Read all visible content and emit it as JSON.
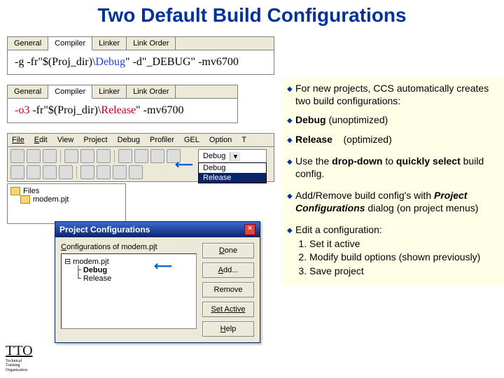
{
  "title": "Two Default Build Configurations",
  "tabs": {
    "general": "General",
    "compiler": "Compiler",
    "linker": "Linker",
    "linkorder": "Link Order"
  },
  "pane1": {
    "p1": "-g -fr\"$(Proj_dir)\\",
    "p2": "Debug",
    "p3": "\" -d\"_DEBUG\" -mv6700"
  },
  "pane2": {
    "p1": "-o3",
    "p2": " -fr\"$(Proj_dir)\\",
    "p3": "Release",
    "p4": "\" -mv6700"
  },
  "menubar": {
    "file": "File",
    "edit": "Edit",
    "view": "View",
    "project": "Project",
    "debug": "Debug",
    "profiler": "Profiler",
    "gel": "GEL",
    "option": "Option",
    "t": "T"
  },
  "dropdown": {
    "current": "Debug",
    "opt1": "Debug",
    "opt2": "Release"
  },
  "projtree": {
    "root": "Files",
    "item": "modem.pjt"
  },
  "dialog": {
    "title": "Project Configurations",
    "label_pre": "Configurations of ",
    "label_proj": "modem.pjt",
    "root": "modem.pjt",
    "c1": "Debug",
    "c2": "Release",
    "btn_done": "Done",
    "btn_add": "Add...",
    "btn_remove": "Remove",
    "btn_setactive": "Set Active",
    "btn_help": "Help"
  },
  "bullets": {
    "b1a": "For new projects, CCS automatically creates two build configurations:",
    "b1b_pre": "Debug",
    "b1b_post": "  (unoptimized)",
    "b1c_pre": "Release",
    "b1c_post": "    (optimized)",
    "b2": "Use the drop-down to quickly select build config.",
    "b3a": "Add/Remove build config's with ",
    "b3b": "Project Configurations",
    "b3c": " dialog (on project menus)",
    "b4": "Edit a configuration:",
    "s1": "Set it active",
    "s2": "Modify build options (shown previously)",
    "s3": "Save project"
  },
  "footer": {
    "lg": "TTO",
    "l1": "Technical",
    "l2": "Training",
    "l3": "Organization"
  }
}
